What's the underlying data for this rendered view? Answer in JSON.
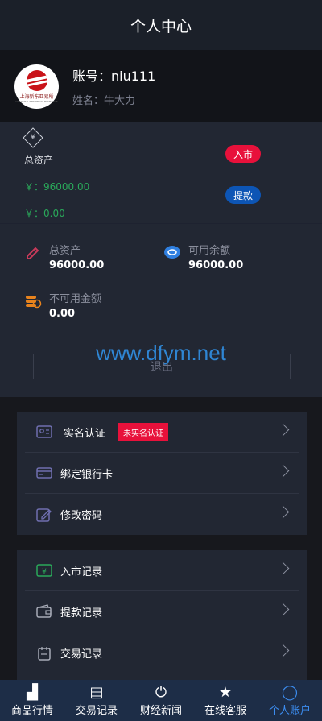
{
  "header": {
    "title": "个人中心"
  },
  "profile": {
    "logo_text": "上海新东亚易所",
    "logo_sub": "SHANGHAI XINDONGYA EXCHANGE",
    "account": "账号：niu111",
    "name": "姓名：牛大力"
  },
  "assets": {
    "title": "总资产",
    "total_line": "￥：96000.00",
    "second_line": "￥：0.00",
    "deposit_button": "入市",
    "withdraw_button": "提款"
  },
  "stats": {
    "total_label": "总资产",
    "total_value": "96000.00",
    "available_label": "可用余额",
    "available_value": "96000.00",
    "unavailable_label": "不可用金额",
    "unavailable_value": "0.00"
  },
  "logout": {
    "label": "退出"
  },
  "watermark": "www.dfym.net",
  "menu1": [
    {
      "label": "实名认证",
      "badge": "未实名认证",
      "icon": "id-card-icon"
    },
    {
      "label": "绑定银行卡",
      "icon": "bank-card-icon"
    },
    {
      "label": "修改密码",
      "icon": "edit-icon"
    }
  ],
  "menu2": [
    {
      "label": "入市记录",
      "icon": "deposit-record-icon"
    },
    {
      "label": "提款记录",
      "icon": "wallet-icon"
    },
    {
      "label": "交易记录",
      "icon": "calendar-icon"
    }
  ],
  "tabbar": [
    {
      "label": "商品行情",
      "icon": "chart-icon",
      "glyph": "▟"
    },
    {
      "label": "交易记录",
      "icon": "document-icon",
      "glyph": "▤"
    },
    {
      "label": "财经新闻",
      "icon": "power-icon",
      "glyph": "⏻"
    },
    {
      "label": "在线客服",
      "icon": "star-icon",
      "glyph": "★"
    },
    {
      "label": "个人账户",
      "icon": "user-icon",
      "glyph": "◯"
    }
  ],
  "colors": {
    "accent_red": "#e8113b",
    "accent_blue": "#0d55b5",
    "positive_green": "#2aa85a",
    "tab_active": "#3c8df0"
  }
}
